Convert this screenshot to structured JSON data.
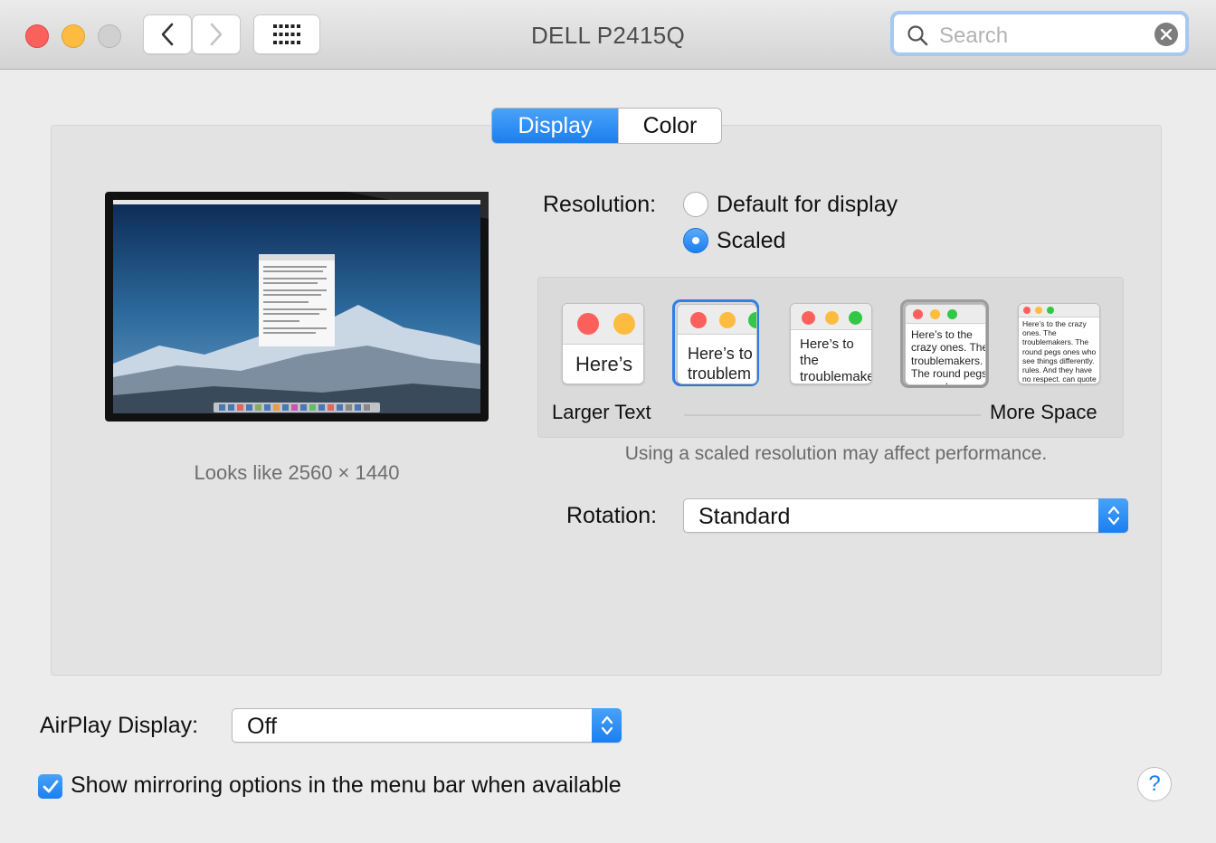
{
  "window": {
    "title": "DELL P2415Q"
  },
  "toolbar": {
    "search_placeholder": "Search"
  },
  "tabs": [
    {
      "label": "Display",
      "selected": true
    },
    {
      "label": "Color",
      "selected": false
    }
  ],
  "display": {
    "looks_like": "Looks like 2560 × 1440"
  },
  "resolution": {
    "label": "Resolution:",
    "options": [
      {
        "label": "Default for display",
        "selected": false
      },
      {
        "label": "Scaled",
        "selected": true
      }
    ],
    "thumbnails": [
      {
        "text": "Here’s",
        "selected": false
      },
      {
        "text": "Here’s to troublem",
        "selected": true
      },
      {
        "text": "Here’s to the troublemakers. ones who see",
        "selected": false
      },
      {
        "text": "Here’s to the crazy ones. The troublemakers. The round pegs ones who see things differently. rules. And they have no",
        "selected": false
      },
      {
        "text": "Here’s to the crazy ones. The troublemakers. The round pegs ones who see things differently. rules. And they have no respect. can quote them, disagree with them. About the only thing. Because they change things.",
        "selected": false
      }
    ],
    "scale_left_label": "Larger Text",
    "scale_right_label": "More Space",
    "note": "Using a scaled resolution may affect performance."
  },
  "rotation": {
    "label": "Rotation:",
    "value": "Standard"
  },
  "airplay": {
    "label": "AirPlay Display:",
    "value": "Off"
  },
  "mirroring": {
    "label": "Show mirroring options in the menu bar when available",
    "checked": true
  },
  "help": {
    "label": "?"
  },
  "colors": {
    "accent": "#1a7ff1",
    "close": "#fc605c",
    "minimize": "#fdbc40",
    "zoom_disabled": "#d0d0d0"
  }
}
